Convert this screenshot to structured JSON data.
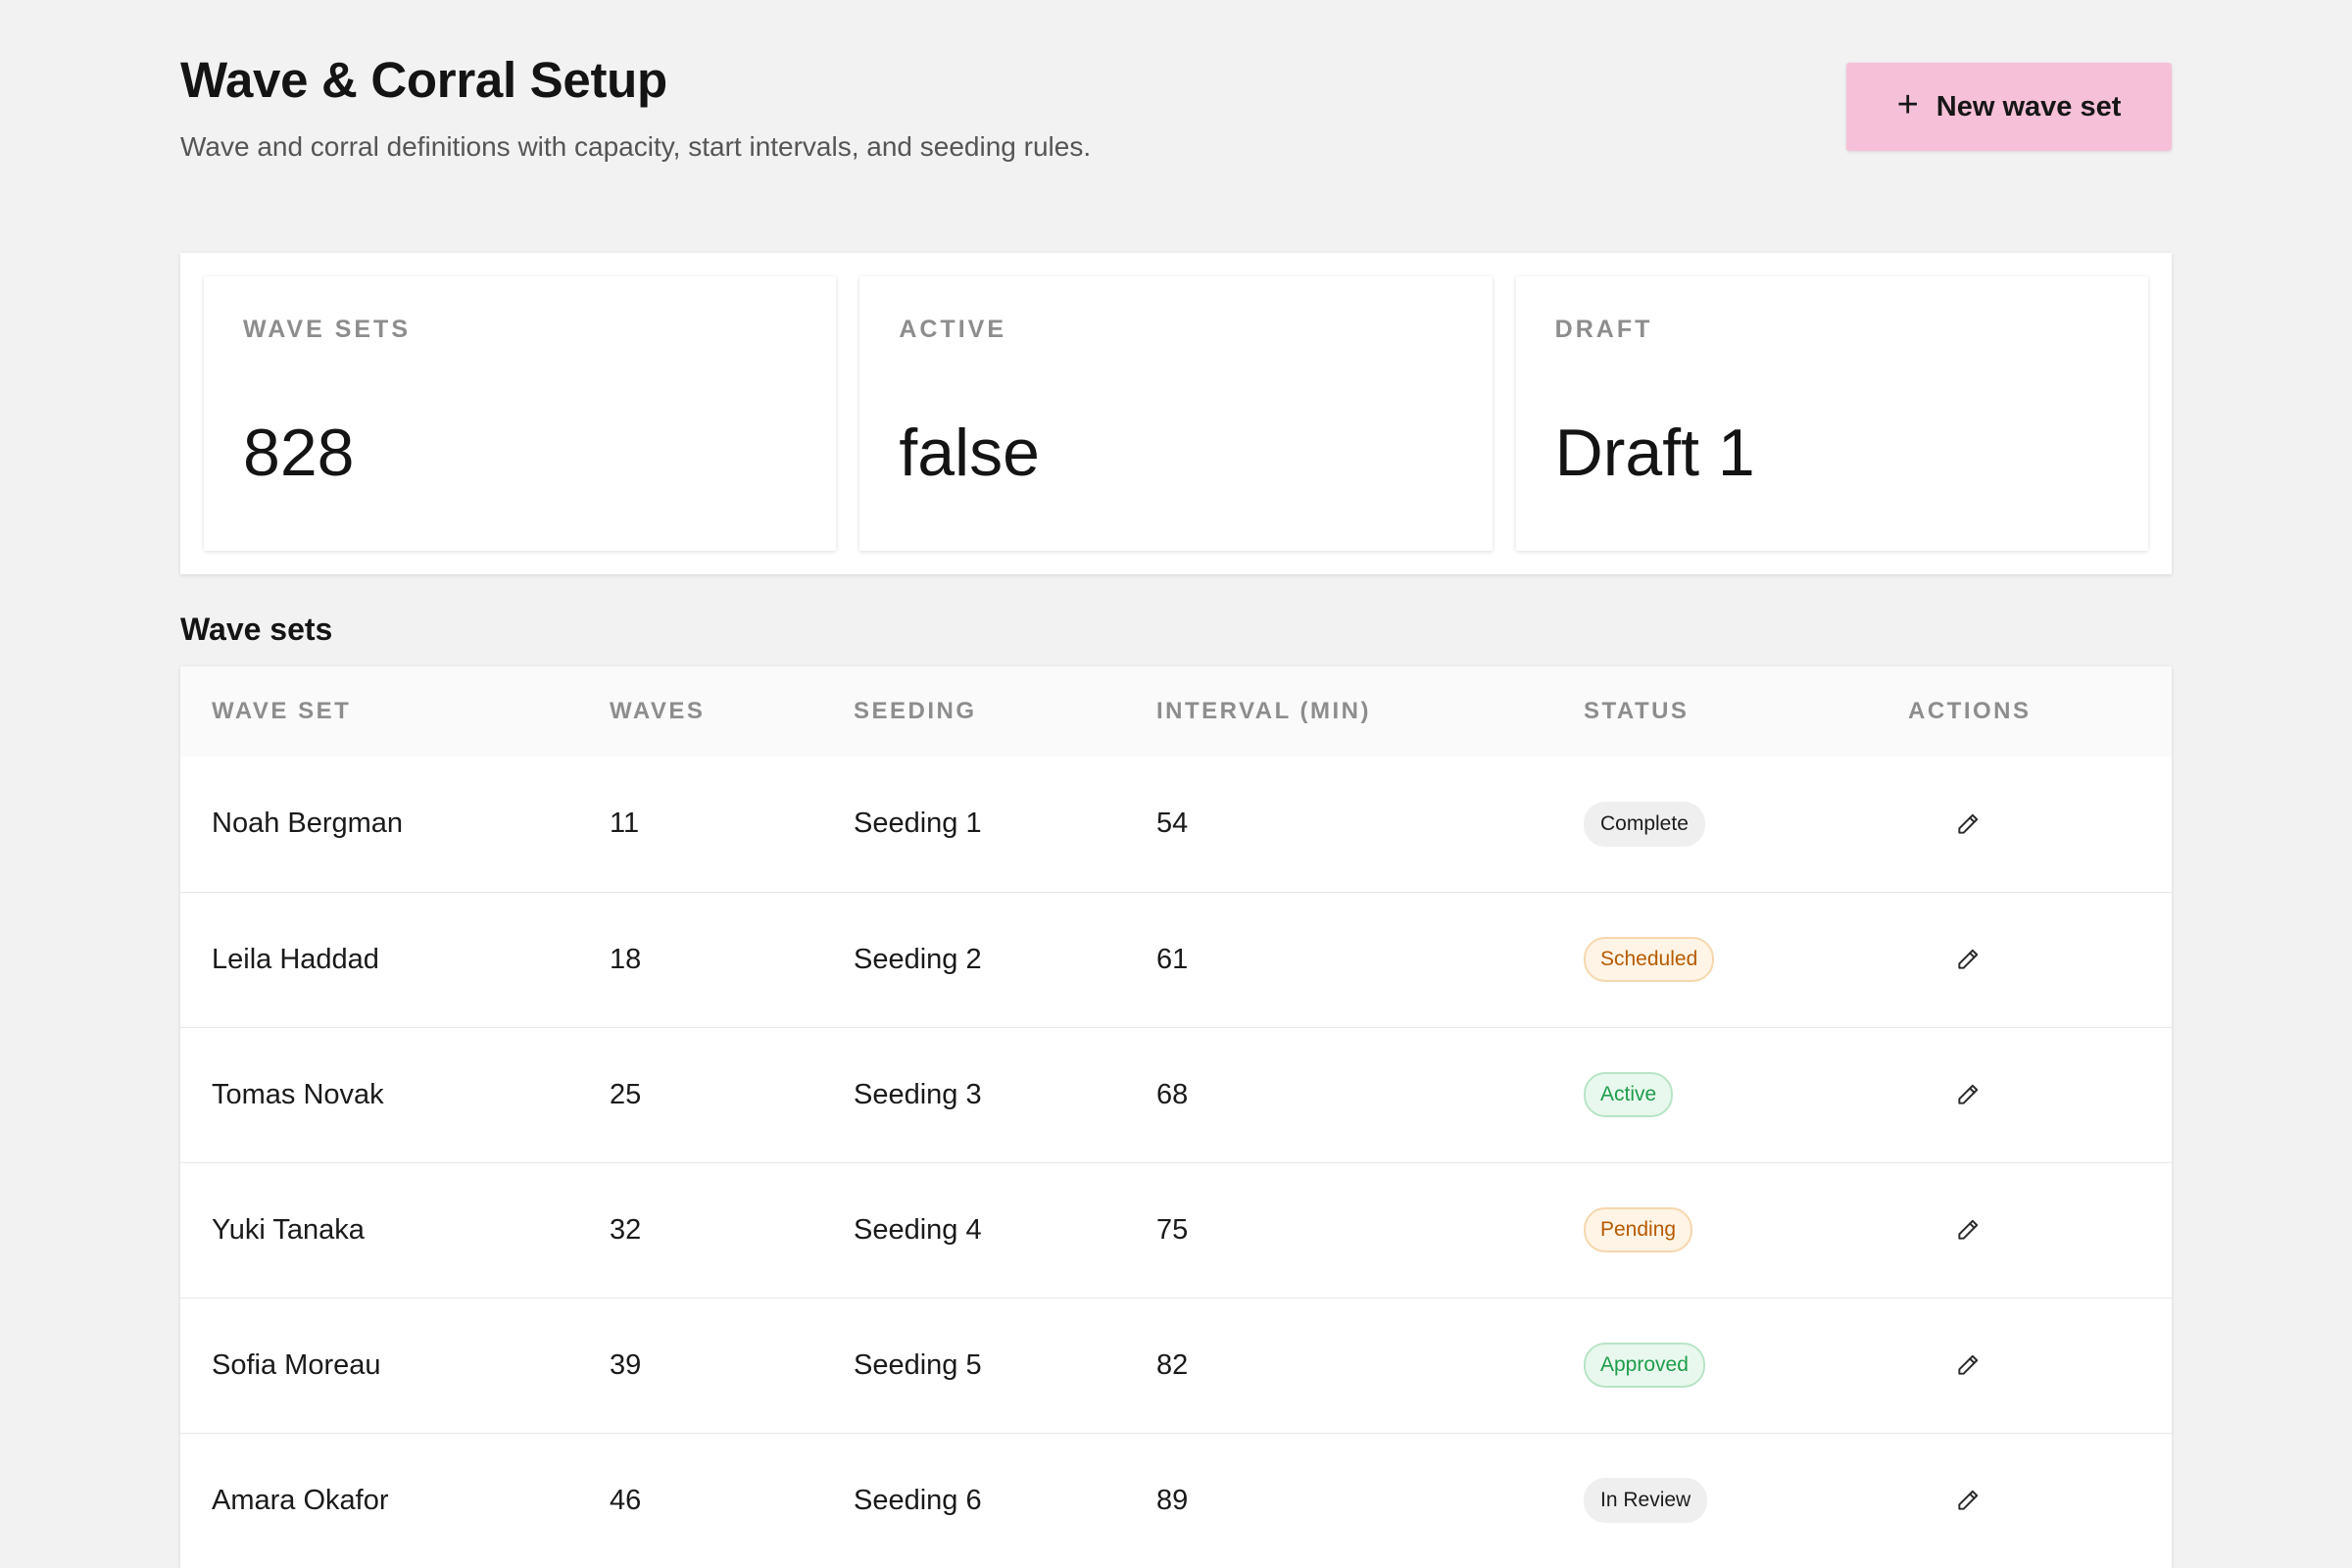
{
  "header": {
    "title": "Wave & Corral Setup",
    "subtitle": "Wave and corral definitions with capacity, start intervals, and seeding rules.",
    "new_button_label": "New wave set",
    "new_button_icon": "plus-icon"
  },
  "stats": [
    {
      "label": "WAVE SETS",
      "value": "828"
    },
    {
      "label": "ACTIVE",
      "value": "false"
    },
    {
      "label": "DRAFT",
      "value": "Draft 1"
    }
  ],
  "section": {
    "title": "Wave sets"
  },
  "table": {
    "columns": [
      "WAVE SET",
      "WAVES",
      "SEEDING",
      "INTERVAL (MIN)",
      "STATUS",
      "ACTIONS"
    ],
    "rows": [
      {
        "wave_set": "Noah Bergman",
        "waves": "11",
        "seeding": "Seeding 1",
        "interval": "54",
        "status": "Complete",
        "status_tone": "neutral"
      },
      {
        "wave_set": "Leila Haddad",
        "waves": "18",
        "seeding": "Seeding 2",
        "interval": "61",
        "status": "Scheduled",
        "status_tone": "warn"
      },
      {
        "wave_set": "Tomas Novak",
        "waves": "25",
        "seeding": "Seeding 3",
        "interval": "68",
        "status": "Active",
        "status_tone": "ok"
      },
      {
        "wave_set": "Yuki Tanaka",
        "waves": "32",
        "seeding": "Seeding 4",
        "interval": "75",
        "status": "Pending",
        "status_tone": "warn"
      },
      {
        "wave_set": "Sofia Moreau",
        "waves": "39",
        "seeding": "Seeding 5",
        "interval": "82",
        "status": "Approved",
        "status_tone": "ok"
      },
      {
        "wave_set": "Amara Okafor",
        "waves": "46",
        "seeding": "Seeding 6",
        "interval": "89",
        "status": "In Review",
        "status_tone": "neutral"
      }
    ],
    "row_action_icon": "pencil-icon"
  },
  "colors": {
    "background": "#f2f2f2",
    "primary_button": "#f6c1d8",
    "status_warn": "#b65a00",
    "status_ok": "#1e9d4b"
  }
}
